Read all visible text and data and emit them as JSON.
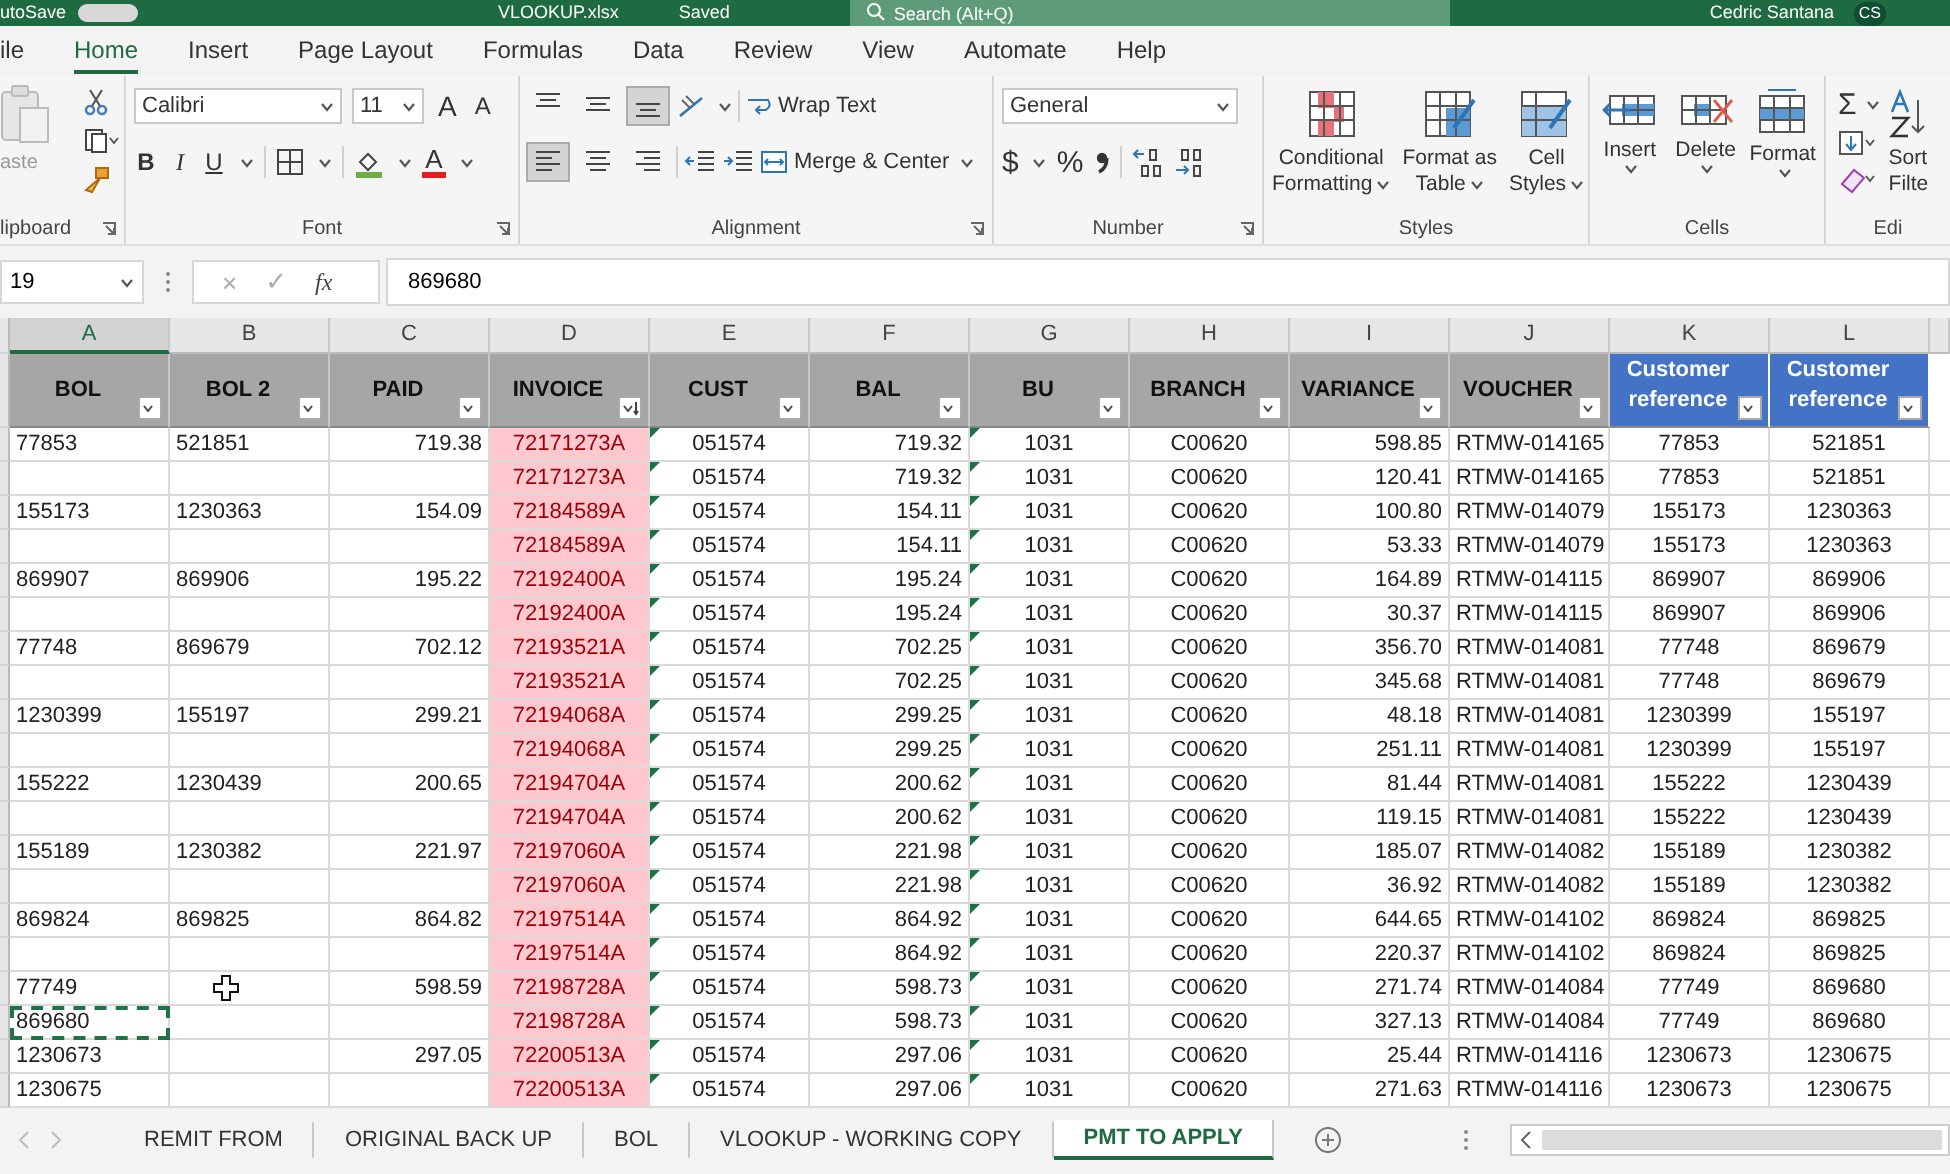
{
  "title_bar": {
    "autosave": "utoSave",
    "file_name": "VLOOKUP.xlsx",
    "saved": "Saved",
    "search_placeholder": "Search (Alt+Q)",
    "user_name": "Cedric Santana",
    "user_initials": "CS"
  },
  "menu_tabs": [
    {
      "label": "ile",
      "selected": false
    },
    {
      "label": "Home",
      "selected": true
    },
    {
      "label": "Insert",
      "selected": false
    },
    {
      "label": "Page Layout",
      "selected": false
    },
    {
      "label": "Formulas",
      "selected": false
    },
    {
      "label": "Data",
      "selected": false
    },
    {
      "label": "Review",
      "selected": false
    },
    {
      "label": "View",
      "selected": false
    },
    {
      "label": "Automate",
      "selected": false
    },
    {
      "label": "Help",
      "selected": false
    }
  ],
  "ribbon": [
    {
      "kind": "clipboard",
      "label": "lipboard",
      "paste": "aste"
    },
    {
      "kind": "font",
      "label": "Font",
      "font_name": "Calibri",
      "font_size": "11",
      "grow": "A",
      "shrink": "A",
      "bold": "B",
      "italic": "I",
      "underline": "U",
      "font_color": "A"
    },
    {
      "kind": "alignment",
      "label": "Alignment",
      "wrap_text": "Wrap Text",
      "merge": "Merge & Center",
      "vertical": [
        {
          "selected": false
        },
        {
          "selected": false
        },
        {
          "selected": true
        }
      ],
      "horizontal": [
        {
          "selected": true
        },
        {
          "selected": false
        },
        {
          "selected": false
        }
      ]
    },
    {
      "kind": "number",
      "label": "Number",
      "format": "General",
      "currency": "$",
      "percent": "%"
    },
    {
      "kind": "styles",
      "label": "Styles",
      "buttons": [
        {
          "line1": "Conditional",
          "line2": "Formatting"
        },
        {
          "line1": "Format as",
          "line2": "Table"
        },
        {
          "line1": "Cell",
          "line2": "Styles"
        }
      ]
    },
    {
      "kind": "cells",
      "label": "Cells",
      "buttons": [
        "Insert",
        "Delete",
        "Format"
      ]
    },
    {
      "kind": "editing",
      "label": "Edi",
      "sum": "Σ",
      "sort_line1": "Sort",
      "sort_line2": "Filte"
    }
  ],
  "formula_bar": {
    "name_box": "19",
    "cancel": "×",
    "enter": "✓",
    "function": "fx",
    "value": "869680"
  },
  "columns": [
    {
      "letter": "A",
      "header": "BOL",
      "kind": "gray",
      "selected": true,
      "highlighted": false,
      "flagged": false,
      "sorted": false
    },
    {
      "letter": "B",
      "header": "BOL 2",
      "kind": "gray",
      "selected": false,
      "highlighted": false,
      "flagged": false,
      "sorted": false
    },
    {
      "letter": "C",
      "header": "PAID",
      "kind": "gray",
      "selected": false,
      "highlighted": false,
      "flagged": false,
      "sorted": false
    },
    {
      "letter": "D",
      "header": "INVOICE",
      "kind": "gray",
      "selected": false,
      "highlighted": true,
      "flagged": false,
      "sorted": true
    },
    {
      "letter": "E",
      "header": "CUST",
      "kind": "gray",
      "selected": false,
      "highlighted": false,
      "flagged": true,
      "sorted": false
    },
    {
      "letter": "F",
      "header": "BAL",
      "kind": "gray",
      "selected": false,
      "highlighted": false,
      "flagged": false,
      "sorted": false
    },
    {
      "letter": "G",
      "header": "BU",
      "kind": "gray",
      "selected": false,
      "highlighted": false,
      "flagged": true,
      "sorted": false
    },
    {
      "letter": "H",
      "header": "BRANCH",
      "kind": "gray",
      "selected": false,
      "highlighted": false,
      "flagged": false,
      "sorted": false
    },
    {
      "letter": "I",
      "header": "VARIANCE",
      "kind": "gray",
      "selected": false,
      "highlighted": false,
      "flagged": false,
      "sorted": false
    },
    {
      "letter": "J",
      "header": "VOUCHER",
      "kind": "gray",
      "selected": false,
      "highlighted": false,
      "flagged": false,
      "sorted": false
    },
    {
      "letter": "K",
      "header": "Customer reference",
      "kind": "blue",
      "selected": false,
      "highlighted": false,
      "flagged": false,
      "sorted": false
    },
    {
      "letter": "L",
      "header": "Customer reference",
      "kind": "blue",
      "selected": false,
      "highlighted": false,
      "flagged": false,
      "sorted": false
    }
  ],
  "rows": [
    [
      "77853",
      "521851",
      "719.38",
      "72171273A",
      "051574",
      "719.32",
      "1031",
      "C00620",
      "598.85",
      "RTMW-014165",
      "77853",
      "521851"
    ],
    [
      null,
      null,
      null,
      "72171273A",
      "051574",
      "719.32",
      "1031",
      "C00620",
      "120.41",
      "RTMW-014165",
      "77853",
      "521851"
    ],
    [
      "155173",
      "1230363",
      "154.09",
      "72184589A",
      "051574",
      "154.11",
      "1031",
      "C00620",
      "100.80",
      "RTMW-014079",
      "155173",
      "1230363"
    ],
    [
      null,
      null,
      null,
      "72184589A",
      "051574",
      "154.11",
      "1031",
      "C00620",
      "53.33",
      "RTMW-014079",
      "155173",
      "1230363"
    ],
    [
      "869907",
      "869906",
      "195.22",
      "72192400A",
      "051574",
      "195.24",
      "1031",
      "C00620",
      "164.89",
      "RTMW-014115",
      "869907",
      "869906"
    ],
    [
      null,
      null,
      null,
      "72192400A",
      "051574",
      "195.24",
      "1031",
      "C00620",
      "30.37",
      "RTMW-014115",
      "869907",
      "869906"
    ],
    [
      "77748",
      "869679",
      "702.12",
      "72193521A",
      "051574",
      "702.25",
      "1031",
      "C00620",
      "356.70",
      "RTMW-014081",
      "77748",
      "869679"
    ],
    [
      null,
      null,
      null,
      "72193521A",
      "051574",
      "702.25",
      "1031",
      "C00620",
      "345.68",
      "RTMW-014081",
      "77748",
      "869679"
    ],
    [
      "1230399",
      "155197",
      "299.21",
      "72194068A",
      "051574",
      "299.25",
      "1031",
      "C00620",
      "48.18",
      "RTMW-014081",
      "1230399",
      "155197"
    ],
    [
      null,
      null,
      null,
      "72194068A",
      "051574",
      "299.25",
      "1031",
      "C00620",
      "251.11",
      "RTMW-014081",
      "1230399",
      "155197"
    ],
    [
      "155222",
      "1230439",
      "200.65",
      "72194704A",
      "051574",
      "200.62",
      "1031",
      "C00620",
      "81.44",
      "RTMW-014081",
      "155222",
      "1230439"
    ],
    [
      null,
      null,
      null,
      "72194704A",
      "051574",
      "200.62",
      "1031",
      "C00620",
      "119.15",
      "RTMW-014081",
      "155222",
      "1230439"
    ],
    [
      "155189",
      "1230382",
      "221.97",
      "72197060A",
      "051574",
      "221.98",
      "1031",
      "C00620",
      "185.07",
      "RTMW-014082",
      "155189",
      "1230382"
    ],
    [
      null,
      null,
      null,
      "72197060A",
      "051574",
      "221.98",
      "1031",
      "C00620",
      "36.92",
      "RTMW-014082",
      "155189",
      "1230382"
    ],
    [
      "869824",
      "869825",
      "864.82",
      "72197514A",
      "051574",
      "864.92",
      "1031",
      "C00620",
      "644.65",
      "RTMW-014102",
      "869824",
      "869825"
    ],
    [
      null,
      null,
      null,
      "72197514A",
      "051574",
      "864.92",
      "1031",
      "C00620",
      "220.37",
      "RTMW-014102",
      "869824",
      "869825"
    ],
    [
      "77749",
      null,
      "598.59",
      "72198728A",
      "051574",
      "598.73",
      "1031",
      "C00620",
      "271.74",
      "RTMW-014084",
      "77749",
      "869680"
    ],
    [
      {
        "text": "869680",
        "copied": true
      },
      null,
      null,
      "72198728A",
      "051574",
      "598.73",
      "1031",
      "C00620",
      "327.13",
      "RTMW-014084",
      "77749",
      "869680"
    ],
    [
      "1230673",
      null,
      "297.05",
      "72200513A",
      "051574",
      "297.06",
      "1031",
      "C00620",
      "25.44",
      "RTMW-014116",
      "1230673",
      "1230675"
    ],
    [
      "1230675",
      null,
      null,
      "72200513A",
      "051574",
      "297.06",
      "1031",
      "C00620",
      "271.63",
      "RTMW-014116",
      "1230673",
      "1230675"
    ]
  ],
  "sheet_tabs": [
    {
      "label": "REMIT FROM",
      "selected": false
    },
    {
      "label": "ORIGINAL BACK UP",
      "selected": false
    },
    {
      "label": "BOL",
      "selected": false
    },
    {
      "label": "VLOOKUP - WORKING COPY",
      "selected": false
    },
    {
      "label": "PMT TO APPLY",
      "selected": true
    }
  ]
}
